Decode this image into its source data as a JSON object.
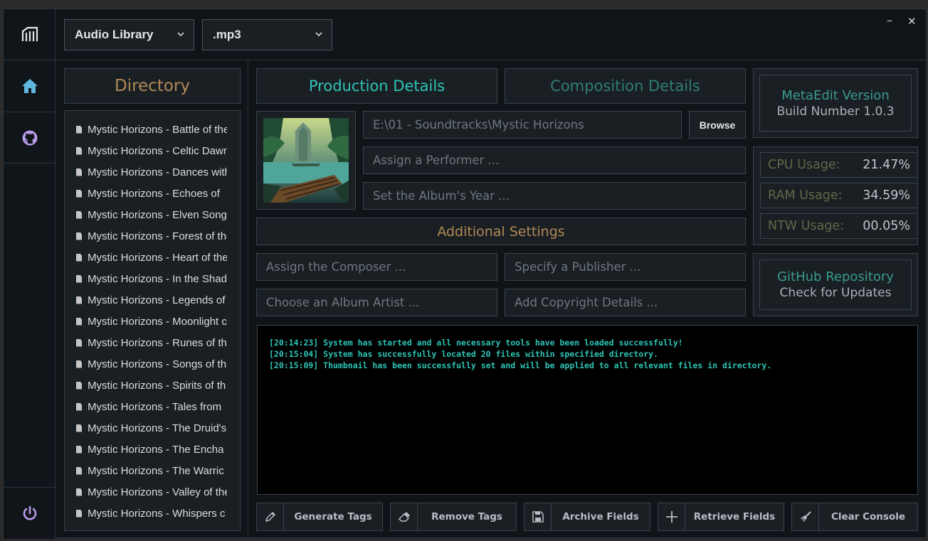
{
  "header": {
    "library_select": "Audio Library",
    "format_select": ".mp3"
  },
  "window": {
    "minimize": "–",
    "close": "✕"
  },
  "sidebar": {
    "logo_icon": "logo-icon",
    "items": [
      "home-icon",
      "github-icon"
    ],
    "power_icon": "power-icon"
  },
  "directory": {
    "title": "Directory",
    "files": [
      "Mystic Horizons - Battle of the",
      "Mystic Horizons - Celtic Dawn",
      "Mystic Horizons - Dances with",
      "Mystic Horizons - Echoes of",
      "Mystic Horizons - Elven Songs",
      "Mystic Horizons - Forest of the",
      "Mystic Horizons - Heart of the",
      "Mystic Horizons - In the Shad",
      "Mystic Horizons - Legends of",
      "Mystic Horizons - Moonlight c",
      "Mystic Horizons - Runes of th",
      "Mystic Horizons - Songs of th",
      "Mystic Horizons - Spirits of th",
      "Mystic Horizons - Tales from",
      "Mystic Horizons - The Druid's",
      "Mystic Horizons - The Encha",
      "Mystic Horizons - The Warric",
      "Mystic Horizons - Valley of the",
      "Mystic Horizons - Whispers c"
    ]
  },
  "tabs": {
    "production": "Production Details",
    "composition": "Composition Details"
  },
  "production": {
    "path_value": "E:\\01 - Soundtracks\\Mystic Horizons",
    "browse_label": "Browse",
    "performer_placeholder": "Assign a Performer ...",
    "year_placeholder": "Set the Album's Year ..."
  },
  "additional": {
    "title": "Additional Settings",
    "composer_placeholder": "Assign the Composer ...",
    "publisher_placeholder": "Specify a Publisher ...",
    "album_artist_placeholder": "Choose an Album Artist ...",
    "copyright_placeholder": "Add Copyright Details ..."
  },
  "version": {
    "title": "MetaEdit Version",
    "build": "Build Number 1.0.3"
  },
  "stats": {
    "cpu_label": "CPU Usage:",
    "cpu_value": "21.47%",
    "ram_label": "RAM Usage:",
    "ram_value": "34.59%",
    "ntw_label": "NTW Usage:",
    "ntw_value": "00.05%"
  },
  "github": {
    "title": "GitHub Repository",
    "subtitle": "Check for Updates"
  },
  "console": {
    "lines": [
      "[20:14:23] System has started and all necessary tools have been loaded successfully!",
      "[20:15:04] System has successfully located 20 files within specified directory.",
      "[20:15:09] Thumbnail has been successfully set and will be applied to all relevant files in directory."
    ]
  },
  "actions": {
    "generate": "Generate Tags",
    "remove": "Remove Tags",
    "archive": "Archive Fields",
    "retrieve": "Retrieve Fields",
    "clear": "Clear Console"
  },
  "colors": {
    "accent_teal": "#2ec4b6",
    "accent_gold": "#b08a55",
    "muted_teal": "#2f7d73",
    "version_teal": "#3a9a8e"
  }
}
